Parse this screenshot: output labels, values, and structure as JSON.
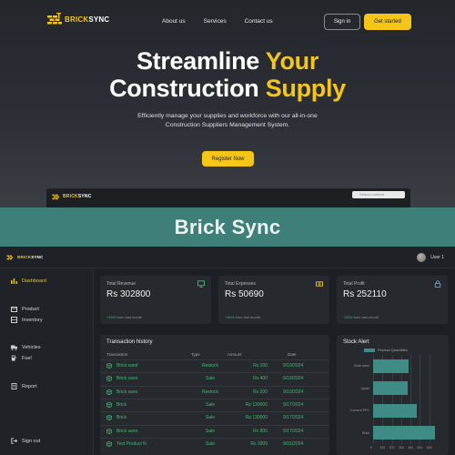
{
  "brand": {
    "part1": "BRICK",
    "part2": "SYNC"
  },
  "nav": {
    "links": [
      "About us",
      "Services",
      "Contact us"
    ],
    "signin": "Sign in",
    "get_started": "Get started"
  },
  "hero": {
    "title_line1_white": "Streamline",
    "title_line1_yellow": "Your",
    "title_line2_white": "Construction",
    "title_line2_yellow": "Supply",
    "subtitle": "Efficiently manage your supplies and workforce with our all-in-one Construction Suppliers Management System.",
    "register": "Register Now"
  },
  "mini_app": {
    "search_placeholder": "Search content"
  },
  "banner": {
    "title": "Brick Sync"
  },
  "dashboard": {
    "user": "User 1",
    "sidebar": [
      {
        "label": "Dashboard",
        "icon": "chart-icon",
        "active": true
      },
      {
        "label": "Product",
        "icon": "box-icon"
      },
      {
        "label": "Inventory",
        "icon": "inventory-icon"
      },
      {
        "label": "Vehicles",
        "icon": "truck-icon"
      },
      {
        "label": "Fuel",
        "icon": "fuel-icon"
      },
      {
        "label": "Report",
        "icon": "report-icon"
      },
      {
        "label": "Sign out",
        "icon": "signout-icon"
      }
    ],
    "cards": [
      {
        "label": "Total Revenue",
        "value": "Rs 302800",
        "change": "+15%",
        "note": "from last month",
        "icon": "monitor-icon"
      },
      {
        "label": "Total Expenses",
        "value": "Rs 50690",
        "change": "+30%",
        "note": "from last month",
        "icon": "cash-icon"
      },
      {
        "label": "Total Profit",
        "value": "Rs 252110",
        "change": "+20%",
        "note": "from last month",
        "icon": "lock-icon"
      }
    ],
    "transactions": {
      "title": "Transaction history",
      "headers": [
        "Transaction",
        "Type",
        "Amount",
        "Date"
      ],
      "rows": [
        [
          "Brick sand",
          "Restock",
          "Rs 100",
          "9/19/2024"
        ],
        [
          "Brick sano",
          "Sale",
          "Rs 400",
          "9/19/2024"
        ],
        [
          "Brick sano",
          "Restock",
          "Rs 200",
          "9/19/2024"
        ],
        [
          "Brick",
          "Sale",
          "Rs 130000",
          "9/17/2024"
        ],
        [
          "Brick",
          "Sale",
          "Rs 130000",
          "9/17/2024"
        ],
        [
          "Brick sano",
          "Sale",
          "Rs 800",
          "9/17/2024"
        ],
        [
          "Test Product N",
          "Sale",
          "Rs 2000",
          "9/15/2024"
        ]
      ]
    },
    "stock": {
      "title": "Stock Alert",
      "legend": "Product Quantities",
      "categories": [
        "Brick sano",
        "Upahi",
        "Cement PPC",
        "Brick"
      ],
      "ticks": [
        "0",
        "100",
        "200",
        "300",
        "400",
        "500",
        "600"
      ]
    }
  },
  "chart_data": {
    "type": "bar",
    "orientation": "horizontal",
    "title": "Stock Alert",
    "categories": [
      "Brick sano",
      "Upahi",
      "Cement PPC",
      "Brick"
    ],
    "series": [
      {
        "name": "Product Quantities",
        "values": [
          380,
          365,
          470,
          660
        ]
      }
    ],
    "xlim": [
      0,
      700
    ],
    "legend": "top"
  },
  "colors": {
    "accent": "#f5c518",
    "teal": "#3f7f79",
    "positive": "#48b878"
  }
}
